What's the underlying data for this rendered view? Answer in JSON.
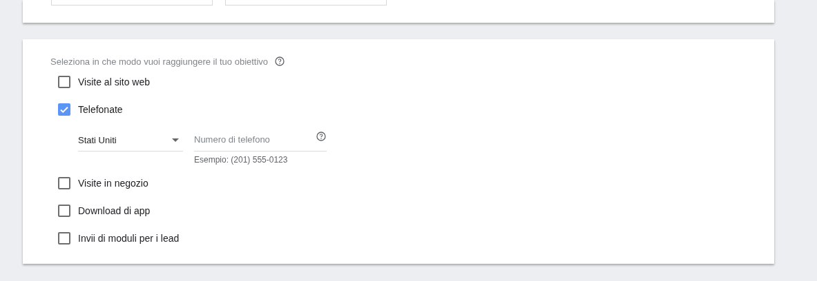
{
  "goal_section": {
    "title": "Seleziona in che modo vuoi raggiungere il tuo obiettivo",
    "options": [
      {
        "label": "Visite al sito web",
        "checked": false
      },
      {
        "label": "Telefonate",
        "checked": true,
        "phone": {
          "country": "Stati Uniti",
          "placeholder": "Numero di telefono",
          "hint": "Esempio: (201) 555-0123"
        }
      },
      {
        "label": "Visite in negozio",
        "checked": false
      },
      {
        "label": "Download di app",
        "checked": false
      },
      {
        "label": "Invii di moduli per i lead",
        "checked": false
      }
    ]
  }
}
